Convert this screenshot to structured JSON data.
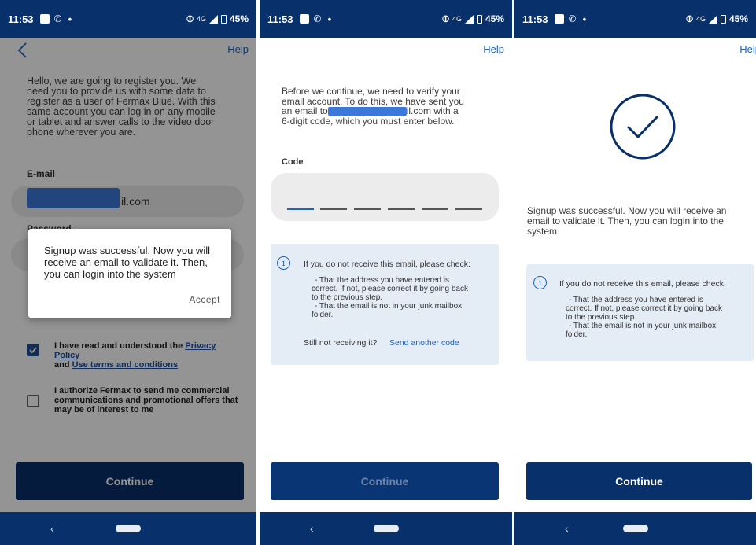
{
  "status_bar": {
    "time": "11:53",
    "network": "4G",
    "battery": "45%"
  },
  "colors": {
    "brand": "#08306b",
    "link": "#2262b8",
    "info_bg": "#e4ecf6"
  },
  "screen1": {
    "help": "Help",
    "intro": [
      "Hello, we are going to register you. We",
      "need you to provide us with some data to",
      "register as a user of Fermax Blue. With this",
      "same account you can log in on any mobile",
      "or tablet and answer calls to the video door",
      "phone wherever you are."
    ],
    "email_label": "E-mail",
    "email_value": "il.com",
    "password_label": "Password",
    "dialog_message": "Signup was successful. Now you will receive an email to validate it. Then, you can login into the system",
    "dialog_accept": "Accept",
    "privacy_prefix": "I have read and understood the ",
    "privacy_link": "Privacy Policy",
    "privacy_and": "and ",
    "terms_link": "Use terms and conditions",
    "privacy_checked": true,
    "marketing_text": [
      "I authorize Fermax to send me commercial",
      "communications and promotional offers that",
      "may be of interest to me"
    ],
    "marketing_checked": false,
    "continue": "Continue"
  },
  "screen2": {
    "help": "Help",
    "intro_line1": "Before we continue, we need to verify your",
    "intro_line2": "email account. To do this, we have sent you",
    "intro_line3_prefix": "an email to",
    "intro_line3_suffix": "il.com with a",
    "intro_line4": "6-digit code, which you must enter below.",
    "code_label": "Code",
    "info_title": "If you do not receive this email, please check:",
    "info_items": [
      "- That the address you have entered is",
      "correct. If not, please correct it by going back",
      "to the previous step.",
      "- That the email is not in your junk mailbox",
      "folder."
    ],
    "resend_question": "Still not receiving it?",
    "resend_link": "Send another code",
    "continue": "Continue"
  },
  "screen3": {
    "help": "Help",
    "success_lines": [
      "Signup was successful. Now you will receive an",
      "email to validate it. Then, you can login into the",
      "system"
    ],
    "info_title": "If you do not receive this email, please check:",
    "info_items": [
      "- That the address you have entered is",
      "correct. If not, please correct it by going back",
      "to the previous step.",
      "- That the email is not in your junk mailbox",
      "folder."
    ],
    "continue": "Continue"
  },
  "icons": [
    "back-arrow-icon",
    "info-icon",
    "check-circle-icon",
    "checkbox-check-icon",
    "nav-back-icon",
    "nav-home-icon",
    "signal-icon",
    "battery-icon",
    "phone-icon"
  ]
}
